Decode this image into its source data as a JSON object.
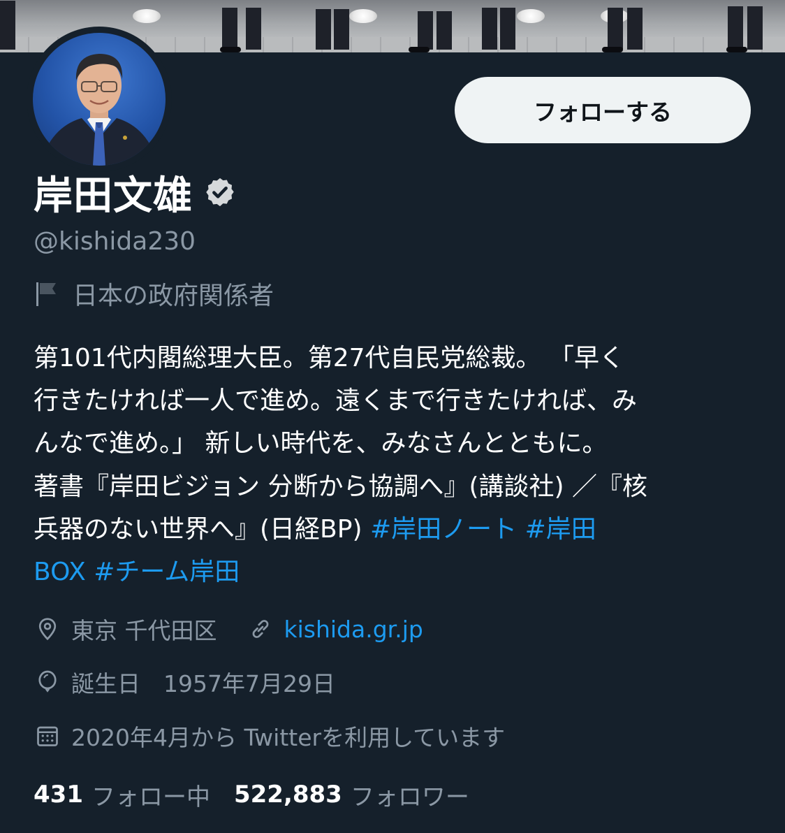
{
  "profile": {
    "display_name": "岸田文雄",
    "handle": "@kishida230",
    "affiliation": "日本の政府関係者",
    "follow_button_label": "フォローする",
    "bio": {
      "line1": "第101代内閣総理大臣。第27代自民党総裁。 「早く",
      "line2": "行きたければ一人で進め。遠くまで行きたければ、み",
      "line3": "んなで進め。」 新しい時代を、みなさんとともに。",
      "line4": "著書『岸田ビジョン 分断から協調へ』(講談社) ／『核",
      "line5_text": "兵器のない世界へ』(日経BP) ",
      "hashtag1": "#岸田ノート",
      "hashtag2_part1": "#岸田",
      "hashtag2_part2": "BOX",
      "hashtag3": "#チーム岸田"
    },
    "location": "東京 千代田区",
    "website": "kishida.gr.jp",
    "birthday": "誕生日　1957年7月29日",
    "joined": "2020年4月から Twitterを利用しています",
    "following_count": "431",
    "following_label": "フォロー中",
    "followers_count": "522,883",
    "followers_label": "フォロワー"
  },
  "icons": {
    "verified": "verified-badge-icon",
    "affiliation": "flag-icon",
    "location": "location-pin-icon",
    "website": "link-icon",
    "birthday": "balloon-icon",
    "joined": "calendar-icon"
  },
  "colors": {
    "background": "#15202b",
    "accent": "#1d9bf0",
    "secondary_text": "#8b98a5",
    "button_bg": "#eff3f4"
  }
}
